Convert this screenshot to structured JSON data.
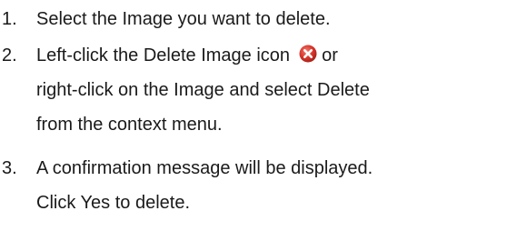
{
  "steps": [
    {
      "number": "1.",
      "lines": [
        "Select the Image you want to delete."
      ]
    },
    {
      "number": "2.",
      "line1_before_icon": "Left-click the Delete Image icon",
      "line1_after_icon": "or",
      "lines": [
        "right-click on the Image and select Delete",
        "from the context menu."
      ],
      "icon": "delete-image-icon",
      "icon_color": "#d9352b"
    },
    {
      "number": "3.",
      "lines": [
        "A confirmation message will be displayed.",
        "Click Yes to delete."
      ]
    }
  ]
}
